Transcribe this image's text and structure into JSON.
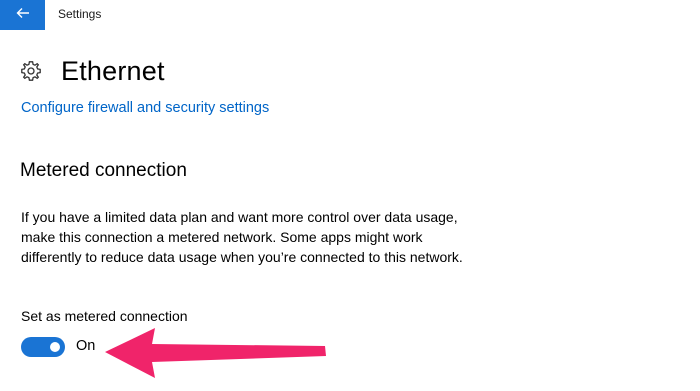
{
  "titlebar": {
    "app_title": "Settings"
  },
  "header": {
    "title": "Ethernet"
  },
  "links": {
    "firewall": "Configure firewall and security settings"
  },
  "metered": {
    "section_title": "Metered connection",
    "description": "If you have a limited data plan and want more control over data usage, make this connection a metered network. Some apps might work differently to reduce data usage when you’re connected to this network.",
    "toggle_label": "Set as metered connection",
    "toggle_state": "On",
    "toggle_on": true
  },
  "colors": {
    "accent": "#1a74d4",
    "link": "#0065c8",
    "annotation_arrow": "#f0246a"
  },
  "icons": {
    "back": "back-arrow-icon",
    "page": "gear-icon"
  }
}
